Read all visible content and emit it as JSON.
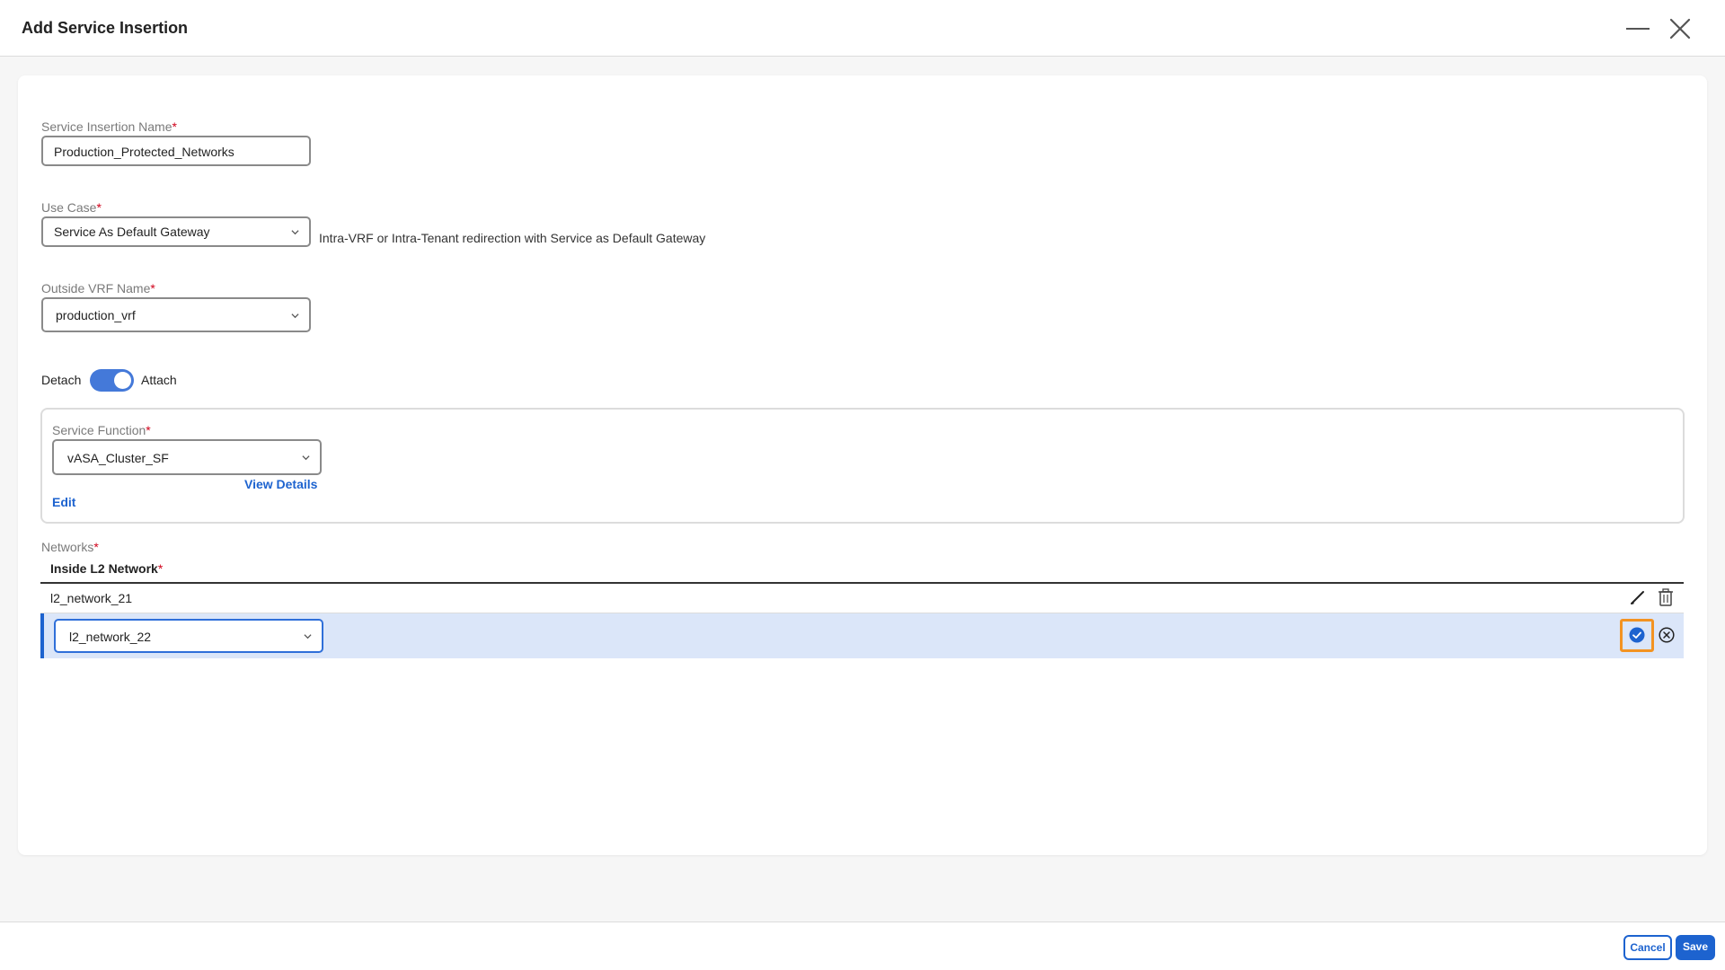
{
  "dialog": {
    "title": "Add Service Insertion"
  },
  "form": {
    "service_insertion_name": {
      "label": "Service Insertion Name",
      "required_mark": "*",
      "value": "Production_Protected_Networks"
    },
    "use_case": {
      "label": "Use Case",
      "required_mark": "*",
      "value": "Service As Default Gateway",
      "hint": "Intra-VRF or Intra-Tenant redirection with Service as Default Gateway"
    },
    "outside_vrf": {
      "label": "Outside VRF Name",
      "required_mark": "*",
      "value": "production_vrf"
    },
    "attach_toggle": {
      "off_label": "Detach",
      "on_label": "Attach",
      "state": "Attach"
    },
    "service_function": {
      "label": "Service Function",
      "required_mark": "*",
      "value": "vASA_Cluster_SF",
      "view_details_label": "View Details",
      "edit_label": "Edit"
    },
    "networks": {
      "label": "Networks",
      "required_mark": "*",
      "column_header": "Inside L2 Network",
      "rows": [
        {
          "value": "l2_network_21"
        },
        {
          "value": "l2_network_22"
        }
      ]
    }
  },
  "footer": {
    "cancel_label": "Cancel",
    "save_label": "Save"
  },
  "colors": {
    "accent": "#1d63cf",
    "toggle_on": "#4479d9",
    "required": "#d0021b",
    "edit_row_bg": "#dbe6f9",
    "highlight": "#f39322"
  },
  "icons": {
    "minimize": "minimize-icon",
    "close": "close-icon",
    "chevron": "chevron-down-icon",
    "edit": "pencil-icon",
    "delete": "trash-icon",
    "confirm": "check-circle-icon",
    "cancel_row": "x-circle-icon"
  }
}
